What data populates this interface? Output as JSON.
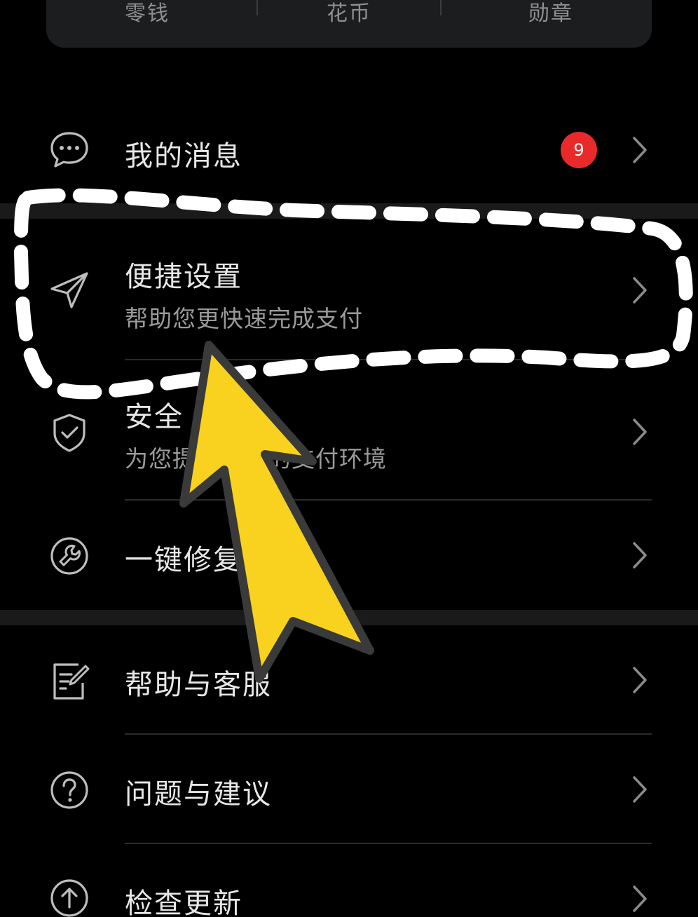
{
  "top_card": {
    "tabs": [
      "零钱",
      "花币",
      "勋章"
    ]
  },
  "menu": {
    "messages": {
      "label": "我的消息",
      "badge": "9"
    },
    "quick_settings": {
      "label": "便捷设置",
      "subtitle": "帮助您更快速完成支付"
    },
    "security": {
      "label": "安全",
      "subtitle": "为您提供安全的支付环境"
    },
    "one_click_repair": {
      "label": "一键修复"
    },
    "help_service": {
      "label": "帮助与客服"
    },
    "feedback": {
      "label": "问题与建议"
    },
    "check_update": {
      "label": "检查更新"
    }
  },
  "icons": {
    "messages": "chat-bubble-icon",
    "quick_settings": "send-icon",
    "security": "shield-check-icon",
    "one_click_repair": "repair-wrench-icon",
    "help_service": "edit-document-icon",
    "feedback": "question-icon",
    "check_update": "arrow-up-circle-icon",
    "chevron": "chevron-right-icon"
  },
  "colors": {
    "background": "#000000",
    "badge": "#ea2a2a",
    "annotation_arrow": "#f8d21e",
    "annotation_dash": "#ffffff"
  }
}
